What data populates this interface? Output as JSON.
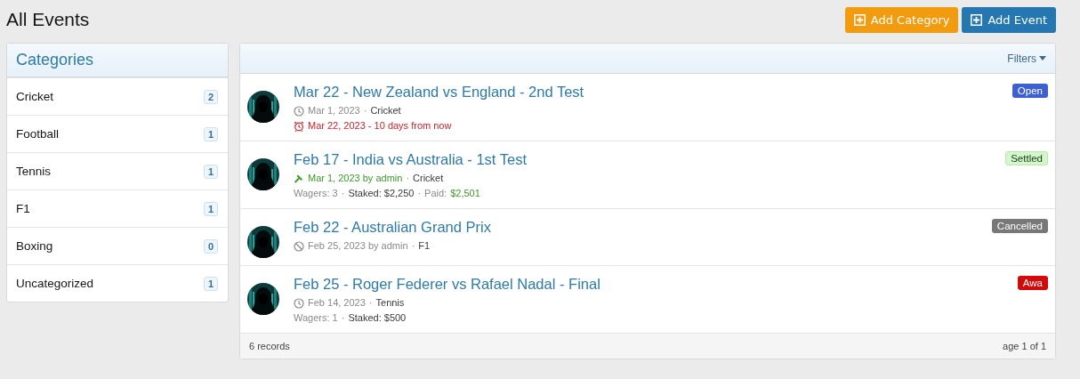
{
  "page_title": "All Events",
  "actions": [
    {
      "label": "Add Category",
      "kind": "secondary"
    },
    {
      "label": "Add Event",
      "kind": "primary"
    }
  ],
  "sidebar": {
    "title": "Categories",
    "items": [
      {
        "label": "Cricket",
        "count": "2"
      },
      {
        "label": "Football",
        "count": "1"
      },
      {
        "label": "Tennis",
        "count": "1"
      },
      {
        "label": "F1",
        "count": "1"
      },
      {
        "label": "Boxing",
        "count": "0"
      },
      {
        "label": "Uncategorized",
        "count": "1"
      }
    ]
  },
  "filters": {
    "label": "Filters"
  },
  "events": [
    {
      "title": "Mar 22 - New Zealand vs England - 2nd Test",
      "status": {
        "label": "Open",
        "kind": "open"
      },
      "lines": [
        {
          "kind": "posted",
          "parts": [
            {
              "text": "Mar 1, 2023",
              "kind": "date"
            },
            {
              "text": "·",
              "kind": "sep"
            },
            {
              "text": "Cricket",
              "kind": "category"
            }
          ]
        },
        {
          "kind": "reminder",
          "parts": [
            {
              "text": "Mar 22, 2023 - 10 days from now",
              "kind": "date"
            }
          ]
        }
      ]
    },
    {
      "title": "Feb 17 - India vs Australia - 1st Test",
      "status": {
        "label": "Settled",
        "kind": "settled"
      },
      "lines": [
        {
          "kind": "settled",
          "parts": [
            {
              "text": "Mar 1, 2023 by admin",
              "kind": "date"
            },
            {
              "text": "·",
              "kind": "sep"
            },
            {
              "text": "Cricket",
              "kind": "category"
            }
          ]
        },
        {
          "kind": "stats",
          "parts": [
            {
              "text": "Wagers: 3",
              "kind": "wagers"
            },
            {
              "text": "·",
              "kind": "sep"
            },
            {
              "text": "Staked: $2,250",
              "kind": "staked"
            },
            {
              "text": "·",
              "kind": "sep"
            },
            {
              "text": "Paid:",
              "kind": "paid_label"
            },
            {
              "text": "$2,501",
              "kind": "paid"
            }
          ]
        }
      ]
    },
    {
      "title": "Feb 22 - Australian Grand Prix",
      "status": {
        "label": "Cancelled",
        "kind": "cancelled"
      },
      "lines": [
        {
          "kind": "cancelled",
          "parts": [
            {
              "text": "Feb 25, 2023 by admin",
              "kind": "date"
            },
            {
              "text": "·",
              "kind": "sep"
            },
            {
              "text": "F1",
              "kind": "category"
            }
          ]
        }
      ]
    },
    {
      "title": "Feb 25 - Roger Federer vs Rafael Nadal - Final",
      "status": {
        "label": "Awa",
        "kind": "awaiting"
      },
      "lines": [
        {
          "kind": "posted",
          "parts": [
            {
              "text": "Feb 14, 2023",
              "kind": "date"
            },
            {
              "text": "·",
              "kind": "sep"
            },
            {
              "text": "Tennis",
              "kind": "category"
            }
          ]
        },
        {
          "kind": "stats",
          "parts": [
            {
              "text": "Wagers: 1",
              "kind": "wagers"
            },
            {
              "text": "·",
              "kind": "sep"
            },
            {
              "text": "Staked: $500",
              "kind": "staked"
            }
          ]
        }
      ]
    }
  ],
  "footer": {
    "records": "6 records",
    "pages": "age 1 of 1"
  }
}
